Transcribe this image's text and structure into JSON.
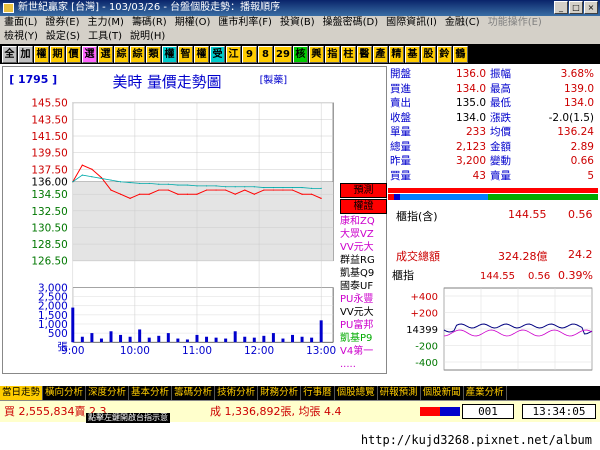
{
  "window": {
    "title": "新世紀贏家 [台灣] - 103/03/26 - 台盤個股走勢：播報順序"
  },
  "menu_row1": [
    "畫面(L)",
    "證券(E)",
    "主力(M)",
    "籌碼(R)",
    "期權(O)",
    "匯市利率(F)",
    "投資(B)",
    "操盤密碼(D)",
    "國際資訊(I)",
    "金融(C)",
    "功能操作(E)"
  ],
  "menu_row2": [
    "檢視(Y)",
    "設定(S)",
    "工具(T)",
    "說明(H)"
  ],
  "toolbar": [
    "全",
    "加",
    "權",
    "期",
    "價",
    "選",
    "選",
    "綜",
    "綜",
    "類",
    "權",
    "智",
    "權",
    "受",
    "江",
    "9",
    "8",
    "29",
    "核",
    "興",
    "指",
    "柱",
    "醫",
    "產",
    "精",
    "基",
    "股",
    "鈴",
    "鶴"
  ],
  "chart": {
    "code": "[ 1795 ]",
    "title": "美時  量價走勢圖",
    "tag": "[製藥]",
    "price_ticks": [
      "145.50",
      "143.50",
      "141.50",
      "139.50",
      "137.50",
      "136.00",
      "134.50",
      "132.50",
      "130.50",
      "128.50",
      "126.50"
    ],
    "volume_ticks": [
      "3,000",
      "2,500",
      "2,000",
      "1,500",
      "1,000",
      "500",
      "張"
    ],
    "time_ticks": [
      "9:00",
      "10:00",
      "11:00",
      "12:00",
      "13:00"
    ],
    "sidebar": [
      "預測",
      "權證",
      "康和ZQ",
      "大眾VZ",
      "VV元大",
      "群益RG",
      "凱基Q9",
      "國泰UF",
      "PU永豐",
      "VV元大",
      "PU富邦",
      "凱基P9",
      "V4第一",
      "....."
    ]
  },
  "chart_data": {
    "type": "line",
    "title": "美時  量價走勢圖",
    "x_labels": [
      "9:00",
      "10:00",
      "11:00",
      "12:00",
      "13:00"
    ],
    "ylim": [
      126.5,
      145.5
    ],
    "reference_price": 136.0,
    "series": [
      {
        "name": "price",
        "values": [
          136.0,
          138.0,
          137.5,
          136.5,
          135.0,
          134.5,
          134.0,
          134.5,
          134.5,
          135.0,
          135.0,
          134.5,
          134.5,
          134.5,
          135.0,
          135.0,
          135.0,
          134.5,
          135.0,
          134.5,
          135.0,
          135.0,
          135.0,
          135.0,
          134.5,
          134.5,
          134.0
        ]
      },
      {
        "name": "average",
        "values": [
          136.0,
          136.8,
          136.6,
          136.4,
          136.2,
          136.0,
          135.9,
          135.8,
          135.8,
          135.7,
          135.7,
          135.6,
          135.6,
          135.5,
          135.5,
          135.5,
          135.4,
          135.4,
          135.4,
          135.4,
          135.3,
          135.3,
          135.3,
          135.3,
          135.3,
          135.2,
          135.2
        ]
      }
    ],
    "volume": [
      1900,
      300,
      500,
      200,
      600,
      400,
      300,
      700,
      250,
      350,
      500,
      200,
      150,
      400,
      300,
      250,
      200,
      600,
      300,
      250,
      350,
      500,
      200,
      400,
      300,
      250,
      1200
    ]
  },
  "quote": [
    {
      "l1": "開盤",
      "v1": "136.0",
      "l2": "振幅",
      "v2": "3.68%"
    },
    {
      "l1": "買進",
      "v1": "134.0",
      "l2": "最高",
      "v2": "139.0"
    },
    {
      "l1": "賣出",
      "v1": "135.0",
      "l2": "最低",
      "v2": "134.0"
    },
    {
      "l1": "收盤",
      "v1": "134.0",
      "l2": "漲跌",
      "v2": "-2.0(1.5)"
    },
    {
      "l1": "單量",
      "v1": "233",
      "l2": "均價",
      "v2": "136.24"
    },
    {
      "l1": "總量",
      "v1": "2,123",
      "l2": "金額",
      "v2": "2.89"
    },
    {
      "l1": "昨量",
      "v1": "3,200",
      "l2": "變動",
      "v2": "0.66"
    },
    {
      "l1": "買量",
      "v1": "43",
      "l2": "賣量",
      "v2": "5"
    }
  ],
  "indicator": {
    "label1": "櫃指(含)",
    "val1": "144.55",
    "pct1": "0.56",
    "label2": "成交總額",
    "val2": "324.28億",
    "pct2": "24.2"
  },
  "mini": {
    "label": "櫃指",
    "value": "144.55",
    "change": "0.56",
    "pct": "0.39%",
    "ticks": [
      "+400",
      "+200",
      "14399",
      "-200",
      "-400"
    ]
  },
  "tabs": [
    "當日走勢",
    "橫向分析",
    "深度分析",
    "基本分析",
    "籌碼分析",
    "技術分析",
    "財務分析",
    "行事曆",
    "個股總覽",
    "研報預測",
    "個股新聞",
    "產業分析"
  ],
  "status": {
    "text": "買 2,555,834賣 2,3",
    "text2": "成 1,336,892張, 均張 4.4",
    "popup": "點擊左鍵開啟台指示意",
    "code": "001",
    "time": "13:34:05"
  },
  "url": "http://kujd3268.pixnet.net/album",
  "colors": {
    "up": "#ff0000",
    "down": "#00aa00",
    "price_line": "#ff0000",
    "avg_line": "#00aaaa",
    "volume": "#0000cc"
  }
}
